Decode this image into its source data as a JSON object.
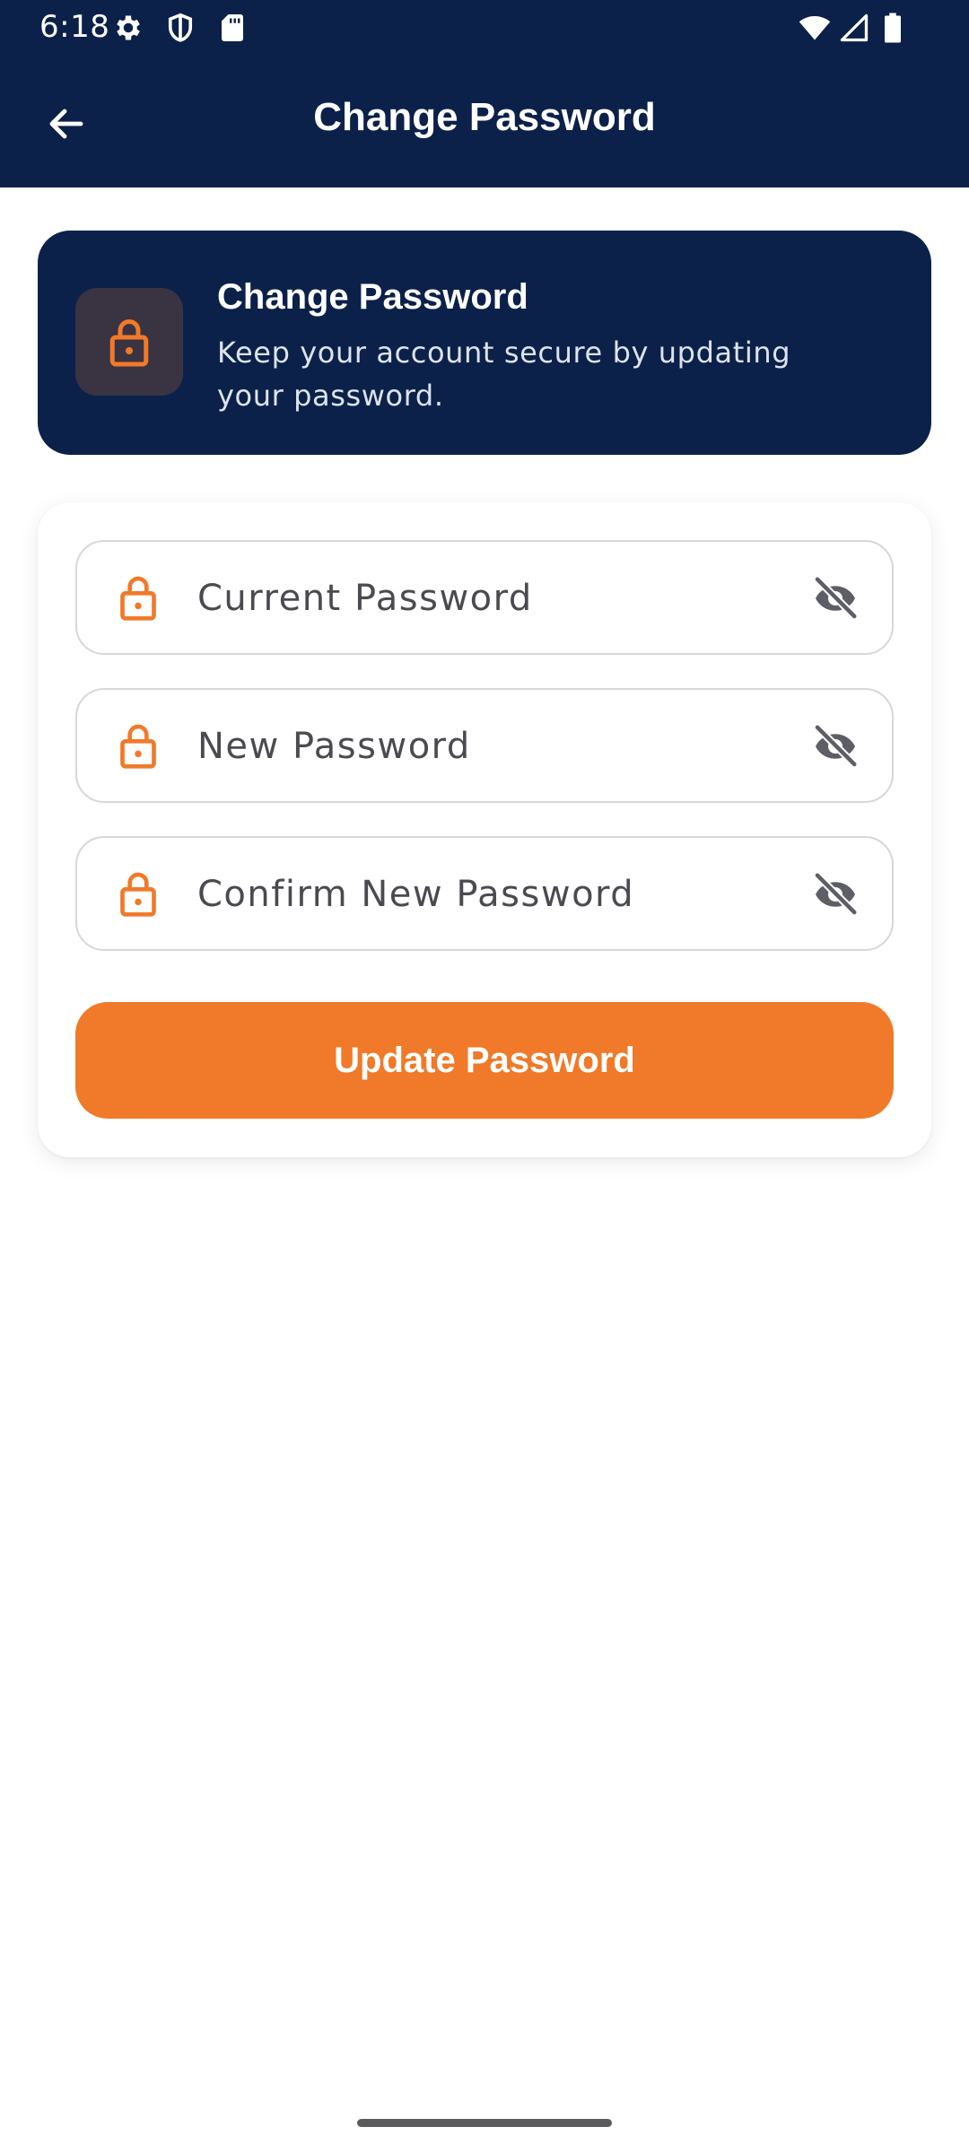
{
  "status_bar": {
    "time": "6:18",
    "left_icons": [
      "gear-icon",
      "shield-icon",
      "sd-card-icon"
    ],
    "right_icons": [
      "wifi-icon",
      "cell-signal-icon",
      "battery-icon"
    ]
  },
  "app_bar": {
    "title": "Change Password",
    "back_icon": "arrow-back-icon"
  },
  "header_card": {
    "icon": "lock-icon",
    "title": "Change Password",
    "description": "Keep your account secure by updating your password."
  },
  "form": {
    "fields": [
      {
        "placeholder": "Current Password",
        "value": "",
        "icon": "lock-icon",
        "toggle_icon": "eye-off-icon"
      },
      {
        "placeholder": "New Password",
        "value": "",
        "icon": "lock-icon",
        "toggle_icon": "eye-off-icon"
      },
      {
        "placeholder": "Confirm New Password",
        "value": "",
        "icon": "lock-icon",
        "toggle_icon": "eye-off-icon"
      }
    ],
    "submit_label": "Update Password"
  },
  "colors": {
    "navy": "#0c2149",
    "accent_orange": "#f07a29",
    "icon_gray": "#5e5e66"
  }
}
